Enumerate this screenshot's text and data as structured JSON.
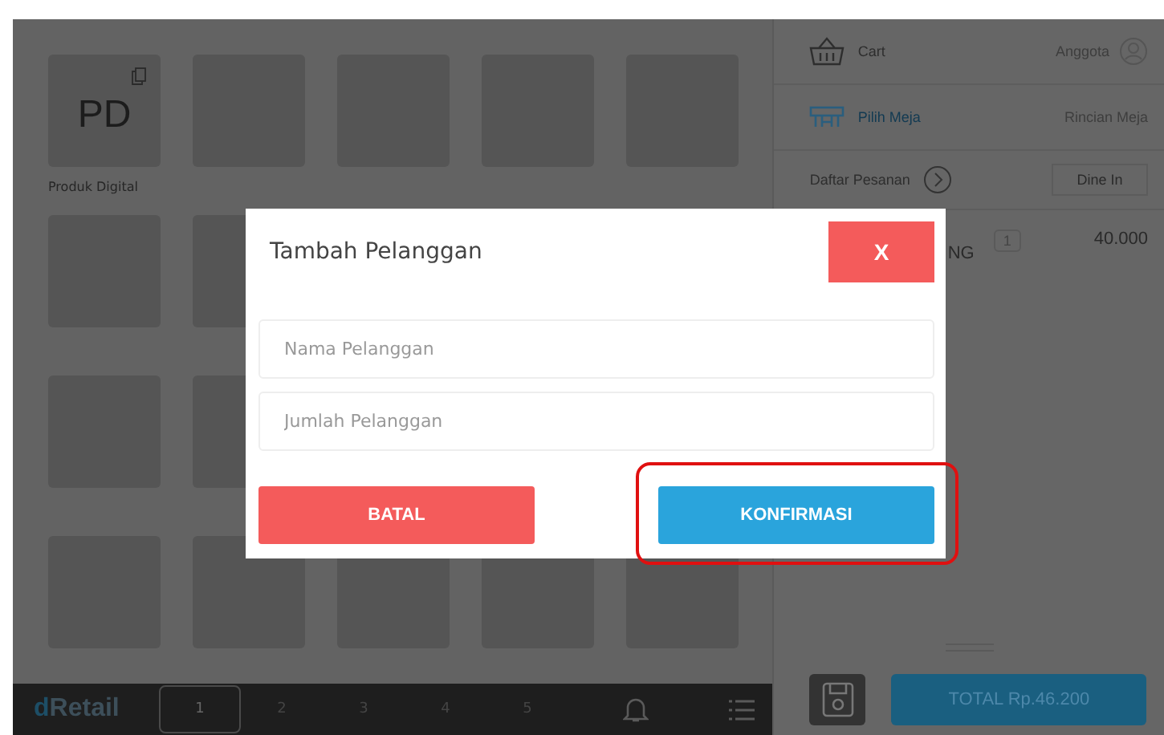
{
  "products": [
    {
      "code": "PD",
      "label": "Produk Digital"
    }
  ],
  "cart": {
    "title": "Cart",
    "member": "Anggota",
    "table_link": "Pilih Meja",
    "table_details": "Rincian Meja",
    "order_list": "Daftar Pesanan",
    "order_type": "Dine In",
    "items": [
      {
        "name": "NG",
        "qty": "1",
        "price": "40.000"
      }
    ],
    "total": "TOTAL Rp.46.200"
  },
  "bottom_bar": {
    "logo_prefix": "d",
    "logo_name": "Retail",
    "tabs": [
      {
        "label": "1",
        "selected": true
      },
      {
        "label": "2",
        "selected": false
      },
      {
        "label": "3",
        "selected": false
      },
      {
        "label": "4",
        "selected": false
      },
      {
        "label": "5",
        "selected": false
      }
    ]
  },
  "dialog": {
    "title": "Tambah Pelanggan",
    "close": "X",
    "fields": [
      {
        "placeholder": "Nama Pelanggan"
      },
      {
        "placeholder": "Jumlah Pelanggan"
      }
    ],
    "cancel": "BATAL",
    "confirm": "KONFIRMASI",
    "confirm_highlighted": true
  }
}
